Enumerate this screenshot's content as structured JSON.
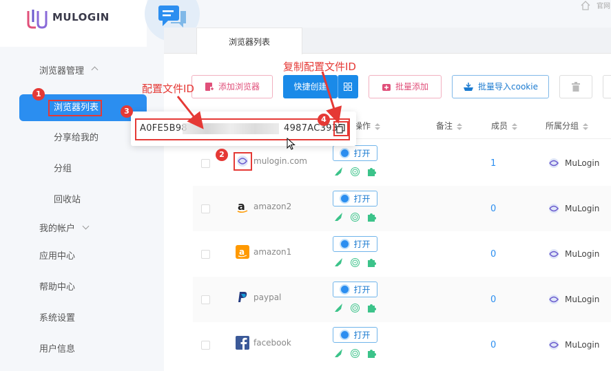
{
  "app": {
    "brand": "MULOGIN",
    "home_text": "官网"
  },
  "sidebar": {
    "group_label": "浏览器管理",
    "items": [
      {
        "label": "浏览器列表",
        "active": true
      },
      {
        "label": "分享给我的"
      },
      {
        "label": "分组"
      },
      {
        "label": "回收站"
      }
    ],
    "account_label": "我的帐户",
    "app_center": "应用中心",
    "help_center": "帮助中心",
    "system_settings": "系统设置",
    "user_info": "用户信息"
  },
  "tabs": {
    "active": "浏览器列表"
  },
  "toolbar": {
    "add_browser": "添加浏览器",
    "quick_create": "快捷创建",
    "batch_add": "批量添加",
    "batch_import_cookie": "批量导入cookie"
  },
  "table": {
    "headers": {
      "actions": "操作",
      "remark": "备注",
      "members": "成员",
      "group": "所属分组"
    },
    "open_label": "打开",
    "rows": [
      {
        "name": "mulogin.com",
        "icon": "mulogin-icon",
        "members": "1",
        "group": "MuLogin"
      },
      {
        "name": "amazon2",
        "icon": "amazon-icon",
        "members": "0",
        "group": "MuLogin"
      },
      {
        "name": "amazon1",
        "icon": "amazon-orange-icon",
        "members": "0",
        "group": "MuLogin"
      },
      {
        "name": "paypal",
        "icon": "paypal-icon",
        "members": "0",
        "group": "MuLogin"
      },
      {
        "name": "facebook",
        "icon": "facebook-icon",
        "members": "0",
        "group": "MuLogin"
      }
    ]
  },
  "popup": {
    "id_prefix": "A0FE5B98",
    "id_suffix": "4987AC393B"
  },
  "annotations": {
    "config_id_label": "配置文件ID",
    "copy_config_id_label": "复制配置文件ID",
    "badges": [
      "1",
      "2",
      "3",
      "4"
    ]
  },
  "colors": {
    "accent": "#2b8ef0",
    "annotation": "#e53935",
    "brand_pink": "#e0507a"
  }
}
